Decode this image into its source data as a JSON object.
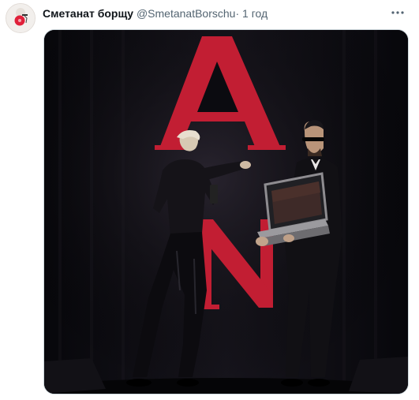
{
  "tweet": {
    "author_name": "Сметанат борщу",
    "author_handle": "@SmetanatBorschu",
    "separator": "·",
    "time": "1 год",
    "media_letters": "A N",
    "icons": {
      "avatar": "avatar-image",
      "more": "more-horizontal-icon",
      "media": "video-still"
    }
  },
  "colors": {
    "stage_bg": "#0b0b10",
    "logo_red": "#c21e33",
    "name_text": "#0f1419",
    "muted_text": "#536471"
  }
}
